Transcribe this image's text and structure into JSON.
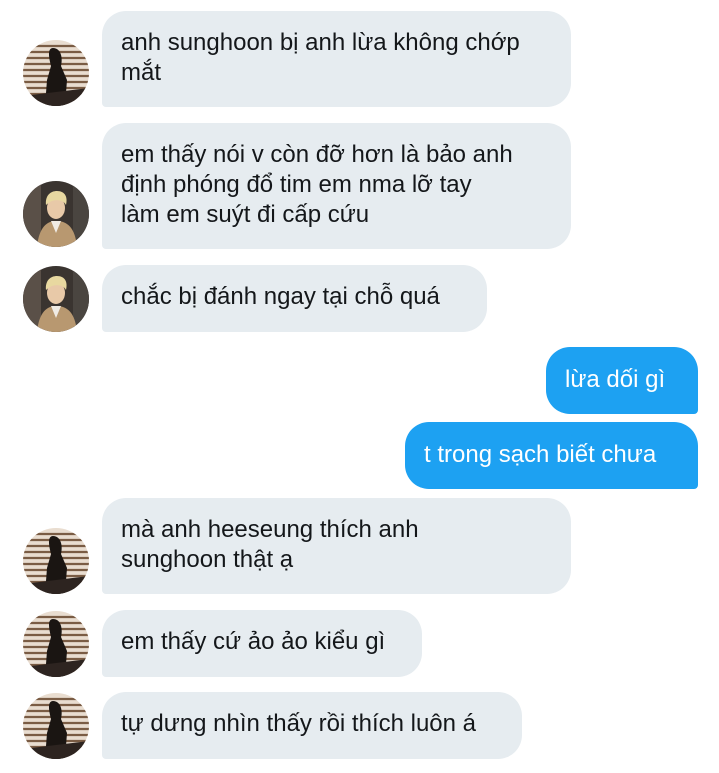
{
  "conversation": {
    "messages": [
      {
        "sender": "them",
        "avatar": "blinds-silhouette-avatar",
        "text": "anh sunghoon bị anh lừa không chớp\nmắt"
      },
      {
        "sender": "them",
        "avatar": "blond-person-avatar",
        "text": "em thấy nói v còn đỡ hơn là bảo anh\nđịnh phóng đổ tim em nma lỡ tay\nlàm em suýt đi cấp cứu"
      },
      {
        "sender": "them",
        "avatar": "blond-person-avatar",
        "text": "chắc bị đánh ngay tại chỗ quá"
      },
      {
        "sender": "me",
        "text": "lừa dối gì"
      },
      {
        "sender": "me",
        "text": "t trong sạch biết chưa"
      },
      {
        "sender": "them",
        "avatar": "blinds-silhouette-avatar",
        "text": "mà anh heeseung thích anh\nsunghoon thật ạ"
      },
      {
        "sender": "them",
        "avatar": "blinds-silhouette-avatar",
        "text": "em thấy cứ ảo ảo kiểu gì"
      },
      {
        "sender": "them",
        "avatar": "blinds-silhouette-avatar",
        "text": "tự dưng nhìn thấy rồi thích luôn á"
      }
    ]
  },
  "colors": {
    "incoming_bubble": "#e6ecf0",
    "outgoing_bubble": "#1da1f2",
    "incoming_text": "#14171a",
    "outgoing_text": "#ffffff"
  }
}
